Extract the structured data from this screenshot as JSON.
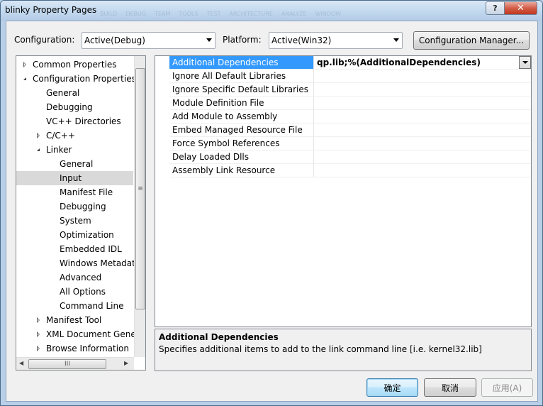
{
  "window": {
    "title": "blinky Property Pages",
    "help_label": "?",
    "close_label": "✕",
    "background_ghost": [
      "BUILD",
      "DEBUG",
      "TEAM",
      "TOOLS",
      "TEST",
      "ARCHITECTURE",
      "ANALYZE",
      "WINDOW"
    ]
  },
  "toolbar": {
    "configuration_label": "Configuration:",
    "configuration_value": "Active(Debug)",
    "platform_label": "Platform:",
    "platform_value": "Active(Win32)",
    "config_manager_label": "Configuration Manager..."
  },
  "tree": {
    "items": [
      {
        "label": "Common Properties",
        "expander": "closed"
      },
      {
        "label": "Configuration Properties",
        "expander": "open"
      },
      {
        "label": "General",
        "expander": "none"
      },
      {
        "label": "Debugging",
        "expander": "none"
      },
      {
        "label": "VC++ Directories",
        "expander": "none"
      },
      {
        "label": "C/C++",
        "expander": "closed"
      },
      {
        "label": "Linker",
        "expander": "open"
      },
      {
        "label": "General",
        "expander": "none"
      },
      {
        "label": "Input",
        "expander": "none",
        "selected": true
      },
      {
        "label": "Manifest File",
        "expander": "none"
      },
      {
        "label": "Debugging",
        "expander": "none"
      },
      {
        "label": "System",
        "expander": "none"
      },
      {
        "label": "Optimization",
        "expander": "none"
      },
      {
        "label": "Embedded IDL",
        "expander": "none"
      },
      {
        "label": "Windows Metadata",
        "expander": "none"
      },
      {
        "label": "Advanced",
        "expander": "none"
      },
      {
        "label": "All Options",
        "expander": "none"
      },
      {
        "label": "Command Line",
        "expander": "none"
      },
      {
        "label": "Manifest Tool",
        "expander": "closed"
      },
      {
        "label": "XML Document Generator",
        "expander": "closed"
      },
      {
        "label": "Browse Information",
        "expander": "closed"
      }
    ],
    "vscroll_grip": "≡",
    "hscroll_grip": "III",
    "scroll_left": "◀",
    "scroll_right": "▶"
  },
  "grid": {
    "rows": [
      {
        "name": "Additional Dependencies",
        "value": "qp.lib;%(AdditionalDependencies)",
        "selected": true
      },
      {
        "name": "Ignore All Default Libraries",
        "value": ""
      },
      {
        "name": "Ignore Specific Default Libraries",
        "value": ""
      },
      {
        "name": "Module Definition File",
        "value": ""
      },
      {
        "name": "Add Module to Assembly",
        "value": ""
      },
      {
        "name": "Embed Managed Resource File",
        "value": ""
      },
      {
        "name": "Force Symbol References",
        "value": ""
      },
      {
        "name": "Delay Loaded Dlls",
        "value": ""
      },
      {
        "name": "Assembly Link Resource",
        "value": ""
      }
    ]
  },
  "description": {
    "title": "Additional Dependencies",
    "text": "Specifies additional items to add to the link command line [i.e. kernel32.lib]"
  },
  "buttons": {
    "ok": "确定",
    "cancel": "取消",
    "apply": "应用(A)"
  },
  "colors": {
    "selection": "#3399ff",
    "tree_selection": "#d9d9d9",
    "close_button": "#c1381f"
  }
}
